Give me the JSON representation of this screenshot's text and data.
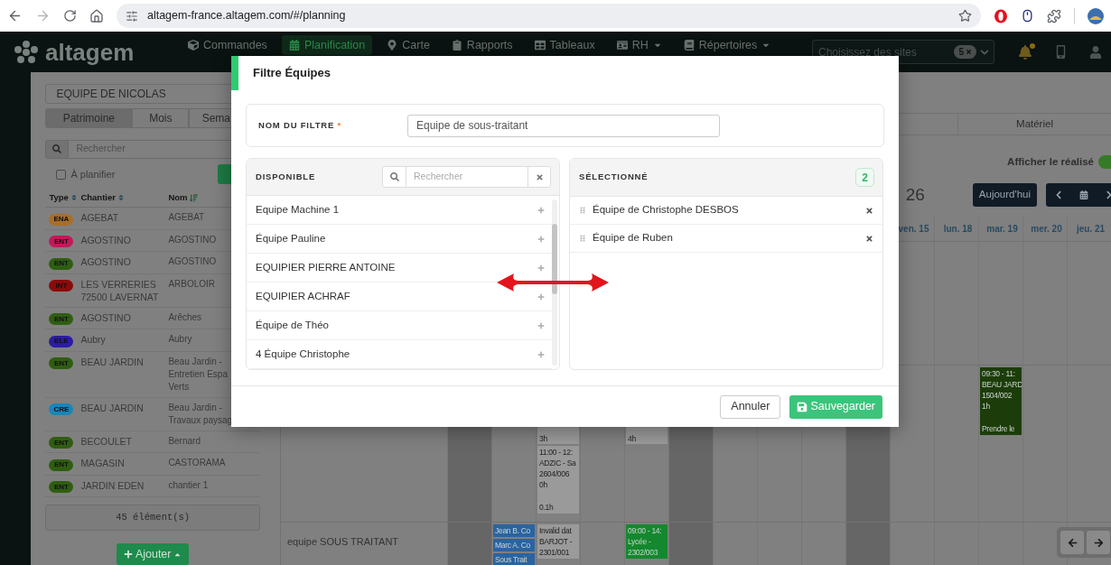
{
  "browser": {
    "url": "altagem-france.altagem.com/#/planning"
  },
  "navbar": {
    "logo": "altagem",
    "items": [
      {
        "label": "Commandes",
        "selected": false,
        "dropdown": false
      },
      {
        "label": "Planification",
        "selected": true,
        "dropdown": false
      },
      {
        "label": "Carte",
        "selected": false,
        "dropdown": false
      },
      {
        "label": "Rapports",
        "selected": false,
        "dropdown": false
      },
      {
        "label": "Tableaux",
        "selected": false,
        "dropdown": false
      },
      {
        "label": "RH",
        "selected": false,
        "dropdown": true
      },
      {
        "label": "Répertoires",
        "selected": false,
        "dropdown": true
      }
    ],
    "site_select": {
      "placeholder": "Choisissez des sites",
      "count": "5"
    }
  },
  "left_panel": {
    "team_select": "EQUIPE DE NICOLAS",
    "tabs": [
      {
        "label": "Patrimoine",
        "selected": true
      },
      {
        "label": "Mois",
        "selected": false
      },
      {
        "label": "Sema",
        "selected": false
      }
    ],
    "search": {
      "placeholder": "Rechercher"
    },
    "filter": {
      "label": "À planifier",
      "checked": false
    },
    "table": {
      "columns": [
        {
          "label": "Type",
          "sorted": false
        },
        {
          "label": "Chantier",
          "sorted": false
        },
        {
          "label": "Nom",
          "sorted": true
        }
      ],
      "rows": [
        {
          "type": "ENA",
          "color": "#a86d2a",
          "chantier": "AGEBAT",
          "nom": [
            "AGEBAT"
          ]
        },
        {
          "type": "ENT",
          "color": "#c2185b",
          "chantier": "AGOSTINO",
          "nom": [
            "AGOSTINO"
          ]
        },
        {
          "type": "ENT",
          "color": "#2e5e10",
          "chantier": "AGOSTINO",
          "nom": [
            "AGOSTINO"
          ]
        },
        {
          "type": "INT",
          "color": "#8b0a0a",
          "chantier": "LES VERRERIES 72500 LAVERNAT",
          "nom": [
            "ARBOLOIR"
          ]
        },
        {
          "type": "ENT",
          "color": "#2e5e10",
          "chantier": "AGOSTINO",
          "nom": [
            "Arêches"
          ]
        },
        {
          "type": "ELE",
          "color": "#2b1aa8",
          "chantier": "Aubry",
          "nom": [
            "Aubry"
          ]
        },
        {
          "type": "ENT",
          "color": "#2e5e10",
          "chantier": "BEAU JARDIN",
          "nom": [
            "Beau Jardin -",
            "Entretien Espa",
            "Verts"
          ]
        },
        {
          "type": "CRE",
          "color": "#1b84b8",
          "chantier": "BEAU JARDIN",
          "nom": [
            "Beau Jardin -",
            "Travaux paysag"
          ]
        },
        {
          "type": "ENT",
          "color": "#2e5e10",
          "chantier": "BECOULET",
          "nom": [
            "Bernard"
          ]
        },
        {
          "type": "ENT",
          "color": "#2e5e10",
          "chantier": "MAGASIN",
          "nom": [
            "CASTORAMA"
          ]
        },
        {
          "type": "ENT",
          "color": "#2e5e10",
          "chantier": "JARDIN EDEN",
          "nom": [
            "chantier 1"
          ]
        }
      ]
    },
    "footer": "45 élément(s)",
    "add_button": "Ajouter"
  },
  "planning": {
    "tabs": [
      {
        "label": "Matériel",
        "selected": false
      }
    ],
    "toggle": {
      "label": "Afficher le réalisé",
      "on": true
    },
    "period_title": "26",
    "today_button": "Aujourd'hui",
    "day_headers": [
      {
        "label": "ven. 15",
        "shaded": false
      },
      {
        "label": "lun. 18",
        "shaded": false
      },
      {
        "label": "mar. 19",
        "shaded": false
      },
      {
        "label": "mer. 20",
        "shaded": false
      },
      {
        "label": "jeu. 21",
        "shaded": false
      }
    ],
    "rows": [
      {
        "days": [
          {
            "shaded": true
          },
          {
            "shaded": false
          },
          {
            "shaded": false,
            "events": [
              {
                "color": "#9a9a9a",
                "lines": [
                  "3h"
                ]
              },
              {
                "color": "#9a9a9a",
                "lines": [
                  "11:00 - 12:",
                  "ADZIC - Sa",
                  "2604/006",
                  "0h"
                ],
                "note": "0.1h"
              }
            ]
          },
          {
            "shaded": false
          },
          {
            "shaded": false,
            "events": [
              {
                "color": "#9a9a9a",
                "lines": [
                  "4h"
                ]
              }
            ]
          },
          {
            "shaded": true
          },
          {
            "shaded": false
          },
          {
            "shaded": false
          },
          {
            "shaded": false
          },
          {
            "shaded": true
          },
          {
            "shaded": false
          },
          {
            "shaded": false
          },
          {
            "shaded": false,
            "events": [
              {
                "color": "#1c3d0a",
                "lines": [
                  "09:30 - 11:",
                  "BEAU JARD",
                  "1504/002",
                  "1h"
                ],
                "note": "Prendre le"
              }
            ]
          },
          {
            "shaded": false
          },
          {
            "shaded": false
          }
        ]
      },
      {
        "label": "equipe SOUS TRAITANT",
        "days": [
          {
            "shaded": true
          },
          {
            "shaded": false,
            "events": [
              {
                "color": "#2a64a0",
                "lines": [
                  "Jean B. Co"
                ]
              },
              {
                "color": "#2a64a0",
                "lines": [
                  "Marc A. Co"
                ]
              },
              {
                "color": "#2a64a0",
                "lines": [
                  "Sous Trait"
                ]
              }
            ]
          },
          {
            "shaded": false,
            "events": [
              {
                "color": "#9a9a9a",
                "lines": [
                  "Invalid dat",
                  "BARJOT -",
                  "2301/001"
                ]
              }
            ]
          },
          {
            "shaded": false
          },
          {
            "shaded": false,
            "events": [
              {
                "color": "#14882e",
                "lines": [
                  "09:00 - 14:",
                  "Lycée -",
                  "2302/003"
                ]
              }
            ]
          },
          {
            "shaded": true
          },
          {
            "shaded": false
          },
          {
            "shaded": false
          },
          {
            "shaded": false
          },
          {
            "shaded": true
          },
          {
            "shaded": false
          },
          {
            "shaded": false
          },
          {
            "shaded": false
          },
          {
            "shaded": false
          },
          {
            "shaded": false
          }
        ]
      }
    ]
  },
  "modal": {
    "title": "Filtre Équipes",
    "name_field": {
      "label": "NOM DU FILTRE",
      "required_mark": "*",
      "value": "Equipe de sous-traitant"
    },
    "available": {
      "title": "DISPONIBLE",
      "search_placeholder": "Rechercher",
      "items": [
        "Equipe Machine 1",
        "Équipe Pauline",
        "EQUIPIER PIERRE ANTOINE",
        "EQUIPIER ACHRAF",
        "Équipe de Théo",
        "4 Équipe Christophe"
      ]
    },
    "selected": {
      "title": "SÉLECTIONNÉ",
      "count": "2",
      "items": [
        "Équipe de Christophe DESBOS",
        "Équipe de Ruben"
      ]
    },
    "cancel_button": "Annuler",
    "save_button": "Sauvegarder"
  }
}
